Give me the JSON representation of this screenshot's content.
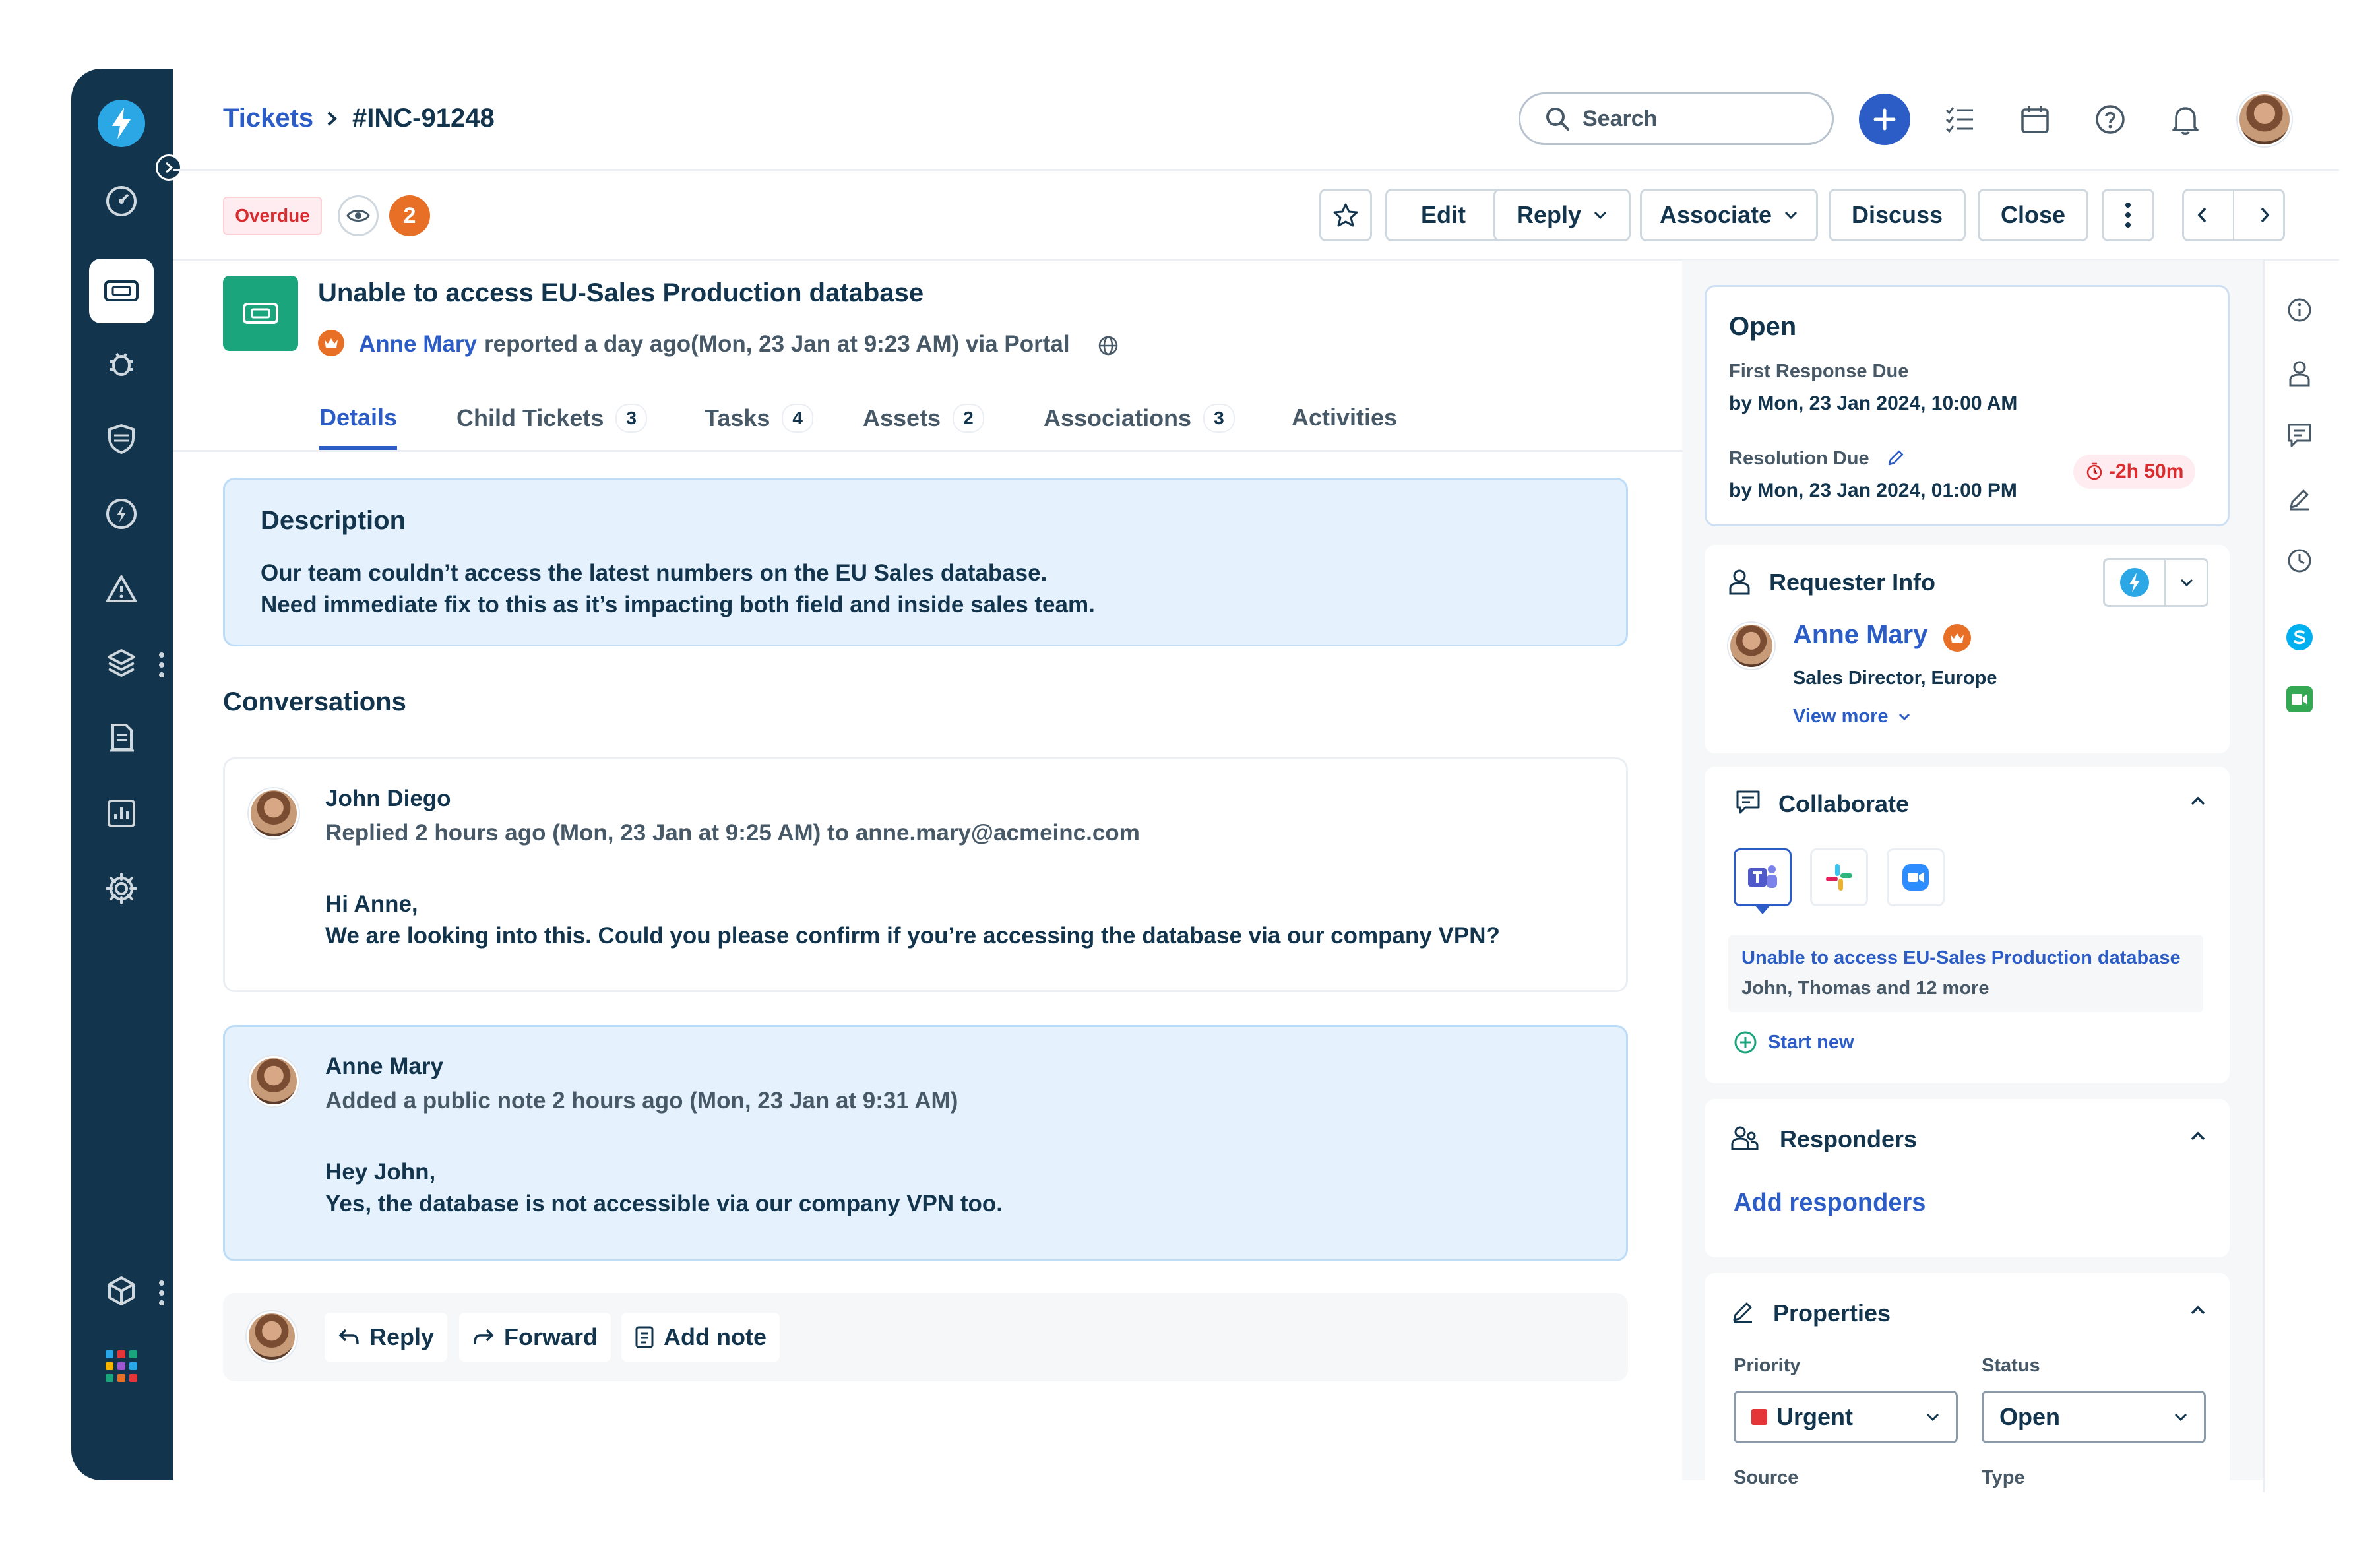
{
  "breadcrumb": {
    "root": "Tickets",
    "separator": ">",
    "ticket_id": "#INC-91248"
  },
  "search": {
    "placeholder": "Search"
  },
  "status_bar": {
    "overdue_label": "Overdue",
    "watchers_count": "2"
  },
  "toolbar": {
    "edit": "Edit",
    "reply": "Reply",
    "associate": "Associate",
    "discuss": "Discuss",
    "close": "Close"
  },
  "ticket": {
    "title": "Unable to access EU-Sales Production database",
    "requester": "Anne Mary",
    "reported_text": "reported a day ago(Mon, 23 Jan at 9:23 AM) via Portal"
  },
  "tabs": [
    {
      "label": "Details",
      "count": ""
    },
    {
      "label": "Child Tickets",
      "count": "3"
    },
    {
      "label": "Tasks",
      "count": "4"
    },
    {
      "label": "Assets",
      "count": "2"
    },
    {
      "label": "Associations",
      "count": "3"
    },
    {
      "label": "Activities",
      "count": ""
    }
  ],
  "description": {
    "heading": "Description",
    "line1": "Our team couldn’t access the latest numbers on the EU Sales database.",
    "line2": "Need immediate fix to this as it’s impacting both field and inside sales team."
  },
  "conversations": {
    "heading": "Conversations",
    "items": [
      {
        "author": "John Diego",
        "meta": "Replied 2 hours ago (Mon, 23 Jan at 9:25 AM) to anne.mary@acmeinc.com",
        "line1": "Hi Anne,",
        "line2": "We are looking into this. Could you please confirm if you’re accessing the database via our company VPN?"
      },
      {
        "author": "Anne Mary",
        "meta": "Added a public note 2 hours ago (Mon, 23 Jan at 9:31 AM)",
        "line1": "Hey John,",
        "line2": "Yes, the database is not accessible via our company VPN too."
      }
    ]
  },
  "compose": {
    "reply": "Reply",
    "forward": "Forward",
    "add_note": "Add note"
  },
  "sla": {
    "status": "Open",
    "first_response_label": "First Response Due",
    "first_response_value": "by Mon, 23 Jan 2024, 10:00 AM",
    "resolution_label": "Resolution Due",
    "resolution_value": "by Mon, 23 Jan 2024, 01:00 PM",
    "overdue_timer": "-2h 50m"
  },
  "requester_info": {
    "heading": "Requester Info",
    "name": "Anne Mary",
    "role": "Sales Director, Europe",
    "view_more": "View more"
  },
  "collaborate": {
    "heading": "Collaborate",
    "thread_title": "Unable to access EU-Sales Production database",
    "thread_members": "John, Thomas and 12 more",
    "start_new": "Start new"
  },
  "responders": {
    "heading": "Responders",
    "add": "Add responders"
  },
  "properties": {
    "heading": "Properties",
    "priority_label": "Priority",
    "priority_value": "Urgent",
    "status_label": "Status",
    "status_value": "Open",
    "source_label": "Source",
    "type_label": "Type"
  },
  "colors": {
    "navy": "#12344d",
    "link_blue": "#2c5cc5",
    "brand_blue": "#2c5cc5",
    "ticket_green": "#1aa57d",
    "overdue_red": "#d72d30",
    "watch_orange": "#e86f26",
    "note_bg": "#e5f2fd",
    "urgent": "#e43538"
  }
}
